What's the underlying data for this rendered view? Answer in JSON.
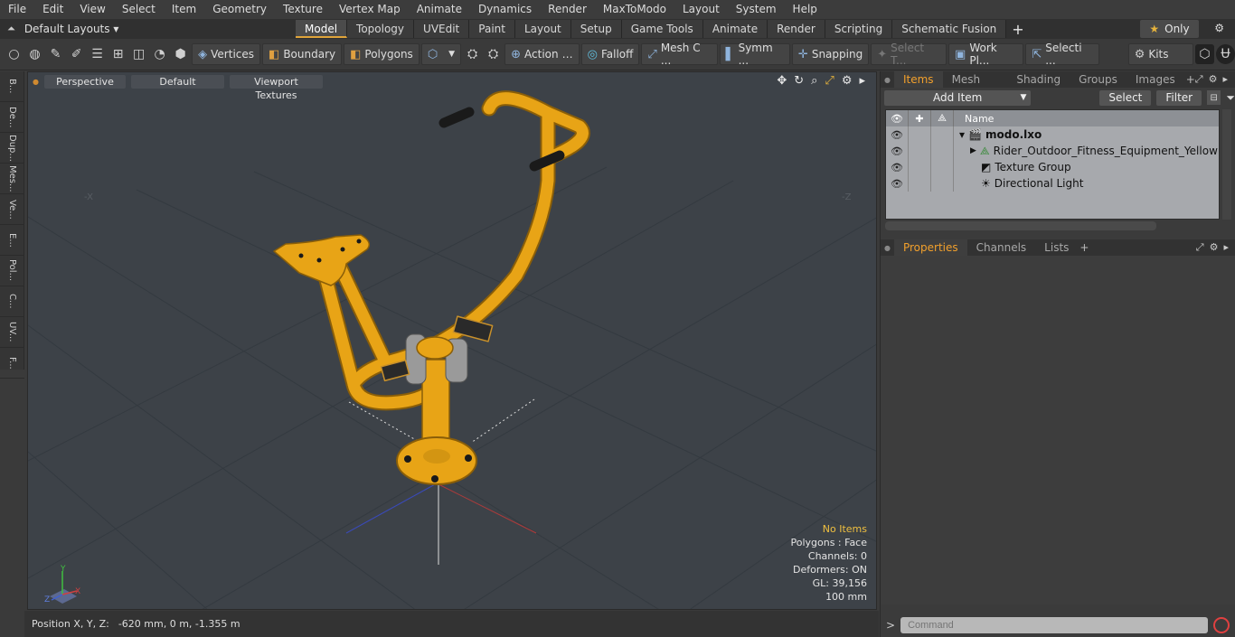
{
  "menu": [
    "File",
    "Edit",
    "View",
    "Select",
    "Item",
    "Geometry",
    "Texture",
    "Vertex Map",
    "Animate",
    "Dynamics",
    "Render",
    "MaxToModo",
    "Layout",
    "System",
    "Help"
  ],
  "layouts": {
    "label": "Default Layouts ▾"
  },
  "tabs": [
    "Model",
    "Topology",
    "UVEdit",
    "Paint",
    "Layout",
    "Setup",
    "Game Tools",
    "Animate",
    "Render",
    "Scripting",
    "Schematic Fusion"
  ],
  "active_tab": "Model",
  "only": {
    "label": "Only"
  },
  "toolbar": {
    "vertices": "Vertices",
    "boundary": "Boundary",
    "polygons": "Polygons",
    "action": "Action",
    "falloff": "Falloff",
    "mesh": "Mesh C ...",
    "symm": "Symm ...",
    "snapping": "Snapping",
    "select_t": "Select T...",
    "work_pl": "Work Pl...",
    "selecti": "Selecti ...",
    "kits": "Kits"
  },
  "left_tabs": [
    "B...",
    "De...",
    "Dup...",
    "Mes...",
    "Ve...",
    "E...",
    "Pol...",
    "C...",
    "UV...",
    "F..."
  ],
  "viewport": {
    "projection": "Perspective",
    "shading": "Default",
    "textures": "Viewport Textures",
    "axis_x": "-X",
    "axis_z": "-Z",
    "info": {
      "selection": "No Items",
      "polygons": "Polygons : Face",
      "channels": "Channels: 0",
      "deformers": "Deformers: ON",
      "gl": "GL: 39,156",
      "scale": "100 mm"
    }
  },
  "status": {
    "label": "Position X, Y, Z:",
    "value": "-620 mm, 0 m, -1.355 m"
  },
  "items_panel": {
    "tabs": [
      "Items",
      "Mesh Ops",
      "Shading",
      "Groups",
      "Images"
    ],
    "add_item": "Add Item",
    "select": "Select",
    "filter": "Filter",
    "name_col": "Name",
    "rows": [
      {
        "name": "modo.lxo",
        "bold": true
      },
      {
        "name": "Rider_Outdoor_Fitness_Equipment_Yellow"
      },
      {
        "name": "Texture Group"
      },
      {
        "name": "Directional Light"
      }
    ]
  },
  "props_panel": {
    "tabs": [
      "Properties",
      "Channels",
      "Lists"
    ]
  },
  "command": {
    "placeholder": "Command"
  },
  "colors": {
    "accent": "#f2a02c",
    "equipment": "#e8a416"
  }
}
